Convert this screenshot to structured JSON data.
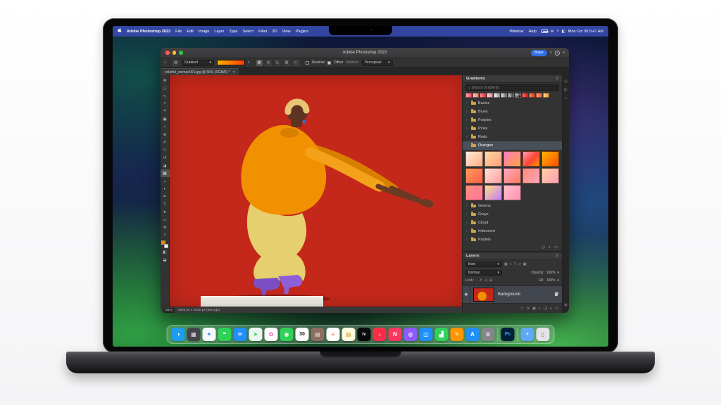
{
  "desktop": {
    "menu_bar": {
      "app_name": "Adobe Photoshop 2023",
      "menus": [
        "File",
        "Edit",
        "Image",
        "Layer",
        "Type",
        "Select",
        "Filter",
        "3D",
        "View",
        "Plugins"
      ],
      "menus_right": [
        "Window",
        "Help"
      ],
      "status_icons": {
        "wifi": "≋",
        "search": "⌕",
        "control_center": "◧"
      },
      "clock": "Mon Oct 30 9:41 AM"
    },
    "dock": {
      "apps": [
        {
          "name": "finder",
          "glyph": "◑",
          "bg": "#1e9cf0",
          "fg": "#ffffff"
        },
        {
          "name": "launchpad",
          "glyph": "▦",
          "bg": "#44444a",
          "fg": "#e8e8ec"
        },
        {
          "name": "safari",
          "glyph": "✦",
          "bg": "#f4f7fb",
          "fg": "#1f8ff9"
        },
        {
          "name": "messages",
          "glyph": "❝",
          "bg": "#30d158",
          "fg": "#ffffff"
        },
        {
          "name": "mail",
          "glyph": "✉",
          "bg": "#1f8ff9",
          "fg": "#ffffff"
        },
        {
          "name": "maps",
          "glyph": "➤",
          "bg": "#e9f6ee",
          "fg": "#34c759"
        },
        {
          "name": "photos",
          "glyph": "✿",
          "bg": "#ffffff",
          "fg": "#fa5aa5"
        },
        {
          "name": "facetime",
          "glyph": "◉",
          "bg": "#30d158",
          "fg": "#ffffff"
        },
        {
          "name": "calendar",
          "glyph": "30",
          "bg": "#ffffff",
          "fg": "#1c1c1e"
        },
        {
          "name": "contacts",
          "glyph": "▤",
          "bg": "#8d6e63",
          "fg": "#f5e9dc"
        },
        {
          "name": "reminders",
          "glyph": "≡",
          "bg": "#ffffff",
          "fg": "#fa3e2c"
        },
        {
          "name": "notes",
          "glyph": "▤",
          "bg": "#fff9e0",
          "fg": "#c9a227"
        },
        {
          "name": "tv",
          "glyph": "tv",
          "bg": "#0a0a0c",
          "fg": "#ffffff"
        },
        {
          "name": "music",
          "glyph": "♪",
          "bg": "#fa2d48",
          "fg": "#ffffff"
        },
        {
          "name": "news",
          "glyph": "N",
          "bg": "#ff375f",
          "fg": "#ffffff"
        },
        {
          "name": "podcasts",
          "glyph": "◍",
          "bg": "#8e5bff",
          "fg": "#ffffff"
        },
        {
          "name": "keynote",
          "glyph": "◫",
          "bg": "#1f8ff9",
          "fg": "#ffffff"
        },
        {
          "name": "numbers",
          "glyph": "▟",
          "bg": "#30d158",
          "fg": "#ffffff"
        },
        {
          "name": "pages",
          "glyph": "✎",
          "bg": "#ff9500",
          "fg": "#ffffff"
        },
        {
          "name": "appstore",
          "glyph": "A",
          "bg": "#1f8ff9",
          "fg": "#ffffff"
        },
        {
          "name": "settings",
          "glyph": "⚙",
          "bg": "#85858b",
          "fg": "#ffffff"
        },
        {
          "name": "photoshop",
          "glyph": "Ps",
          "bg": "#001e36",
          "fg": "#31a8ff"
        },
        {
          "name": "downloads",
          "glyph": "▼",
          "bg": "#5fa8f5",
          "fg": "#dbeeff"
        },
        {
          "name": "trash",
          "glyph": "▯",
          "bg": "#e3e3e8",
          "fg": "#7c7c82"
        }
      ]
    }
  },
  "photoshop": {
    "title_bar": {
      "title": "Adobe Photoshop 2023",
      "share_label": "Share"
    },
    "options_bar": {
      "preset_label": "Gradient",
      "gradient_preview": "linear-gradient(90deg,#ffb300,#ff3d00)",
      "type_icons": [
        "▧",
        "◎",
        "◺",
        "▥",
        "◇"
      ],
      "reverse_label": "Reverse",
      "dither_label": "Dither",
      "method_label": "Method:",
      "method_value": "Perceptual"
    },
    "document_tab": "colorful_woman001.jpg @ 56% (RGB/8) *",
    "status_bar": {
      "zoom": "56%",
      "doc_info": "1920 px x 1920 px (300 ppi)"
    },
    "tools": {
      "glyphs": [
        "✥",
        "▢",
        "∿",
        "⌖",
        "⌗",
        "▣",
        "✧",
        "⊕",
        "✐",
        "⌑",
        "↺",
        "◪",
        "▧",
        "◒",
        "◐",
        "✒",
        "T",
        "➤",
        "▭",
        "✜",
        "⌕"
      ],
      "fg_swatch": "#f08300",
      "bg_swatch": "#ffffff"
    },
    "photo": {
      "background": "#c4281b",
      "sweater": "#f29100",
      "sweater_shade": "#d97f00",
      "sleeve": "#f5a21b",
      "pants": "#e5cf6e",
      "skin": "#5f3322",
      "arm_skin": "#6b3a24",
      "hair": "#e8c475",
      "earring": "#2f6fd8",
      "shoe_front": "#7b4fc4",
      "shoe_back": "#8d5fd9",
      "pedestal": "#f2efe9"
    },
    "panels": {
      "gradients": {
        "title": "Gradients",
        "search_placeholder": "Search Gradients",
        "recent_swatches": [
          "linear-gradient(90deg,#ff9aa8,#ff5f6d)",
          "linear-gradient(90deg,#ffc3a0,#ff7a85)",
          "linear-gradient(90deg,#ff8f8f,#e23744)",
          "linear-gradient(90deg,#ffd0d8,#ff8a9a)",
          "linear-gradient(90deg,#f5f5f5,#9e9e9e)",
          "linear-gradient(90deg,#eeeeee,#616161)",
          "linear-gradient(90deg,#cfcfcf,#424242)",
          "linear-gradient(135deg,#ffffff,#000000)",
          "linear-gradient(90deg,#ff6b6b,#c62828)",
          "linear-gradient(90deg,#ff8a65,#d84315)",
          "linear-gradient(90deg,#ffab91,#ff5722)",
          "linear-gradient(90deg,#ffe0b2,#ff9800)"
        ],
        "folders_above": [
          "Basics",
          "Blues",
          "Purples",
          "Pinks",
          "Reds"
        ],
        "selected_folder": "Oranges",
        "orange_swatches": [
          "linear-gradient(135deg,#ffe9e2,#ffb07a)",
          "linear-gradient(135deg,#ffd9a5,#ff9e7a)",
          "linear-gradient(135deg,#ff7ac2,#ffa53d)",
          "linear-gradient(135deg,#ff9ab0,#ff4433 55%,#ff9a00)",
          "linear-gradient(135deg,#ffb300,#ff4d00)",
          "linear-gradient(135deg,#ff9a5c,#ff5f49)",
          "linear-gradient(135deg,#ffe0d6,#ffa0a0)",
          "linear-gradient(135deg,#ffa9c9,#ff7a58)",
          "linear-gradient(135deg,#ff8a78,#ffa6b8)",
          "linear-gradient(135deg,#ffcf9e,#ff9eb8)",
          "linear-gradient(135deg,#ff9078,#ff74a0)",
          "linear-gradient(135deg,#ffdf7e,#c47aff)",
          "linear-gradient(135deg,#ffc0cd,#ff8fae)"
        ],
        "folders_below": [
          "Greens",
          "Grays",
          "Cloud",
          "Iridescent",
          "Pastels"
        ]
      },
      "layers": {
        "title": "Layers",
        "kind": "Kind",
        "filter_icons": [
          "▦",
          "◑",
          "T",
          "▱",
          "▣"
        ],
        "blend_mode": "Normal",
        "opacity_label": "Opacity:",
        "opacity_value": "100%",
        "lock_label": "Lock:",
        "lock_icons": [
          "▫",
          "✐",
          "✛",
          "⊞"
        ],
        "fill_label": "Fill:",
        "fill_value": "100%",
        "layer_name": "Background",
        "thumb": "radial-gradient(circle at 42% 62%, #f29100 0 30%, #c4281b 34%)",
        "footer_icons": [
          "⊂",
          "fx",
          "▣",
          "◐",
          "❏",
          "+",
          "▭"
        ]
      }
    },
    "colors": {
      "accent_blue": "#2f6fed",
      "canvas_red": "#c4281b"
    },
    "icons": {
      "panel_menu": "≡",
      "search": "⌕",
      "arrow_collapsed": "›",
      "arrow_expanded": "⌄",
      "chevron": "▾",
      "close": "×",
      "help": "?",
      "home": "⌂",
      "eye": "◉",
      "new": "+",
      "delete": "▭",
      "group": "❏",
      "more": "»"
    }
  }
}
